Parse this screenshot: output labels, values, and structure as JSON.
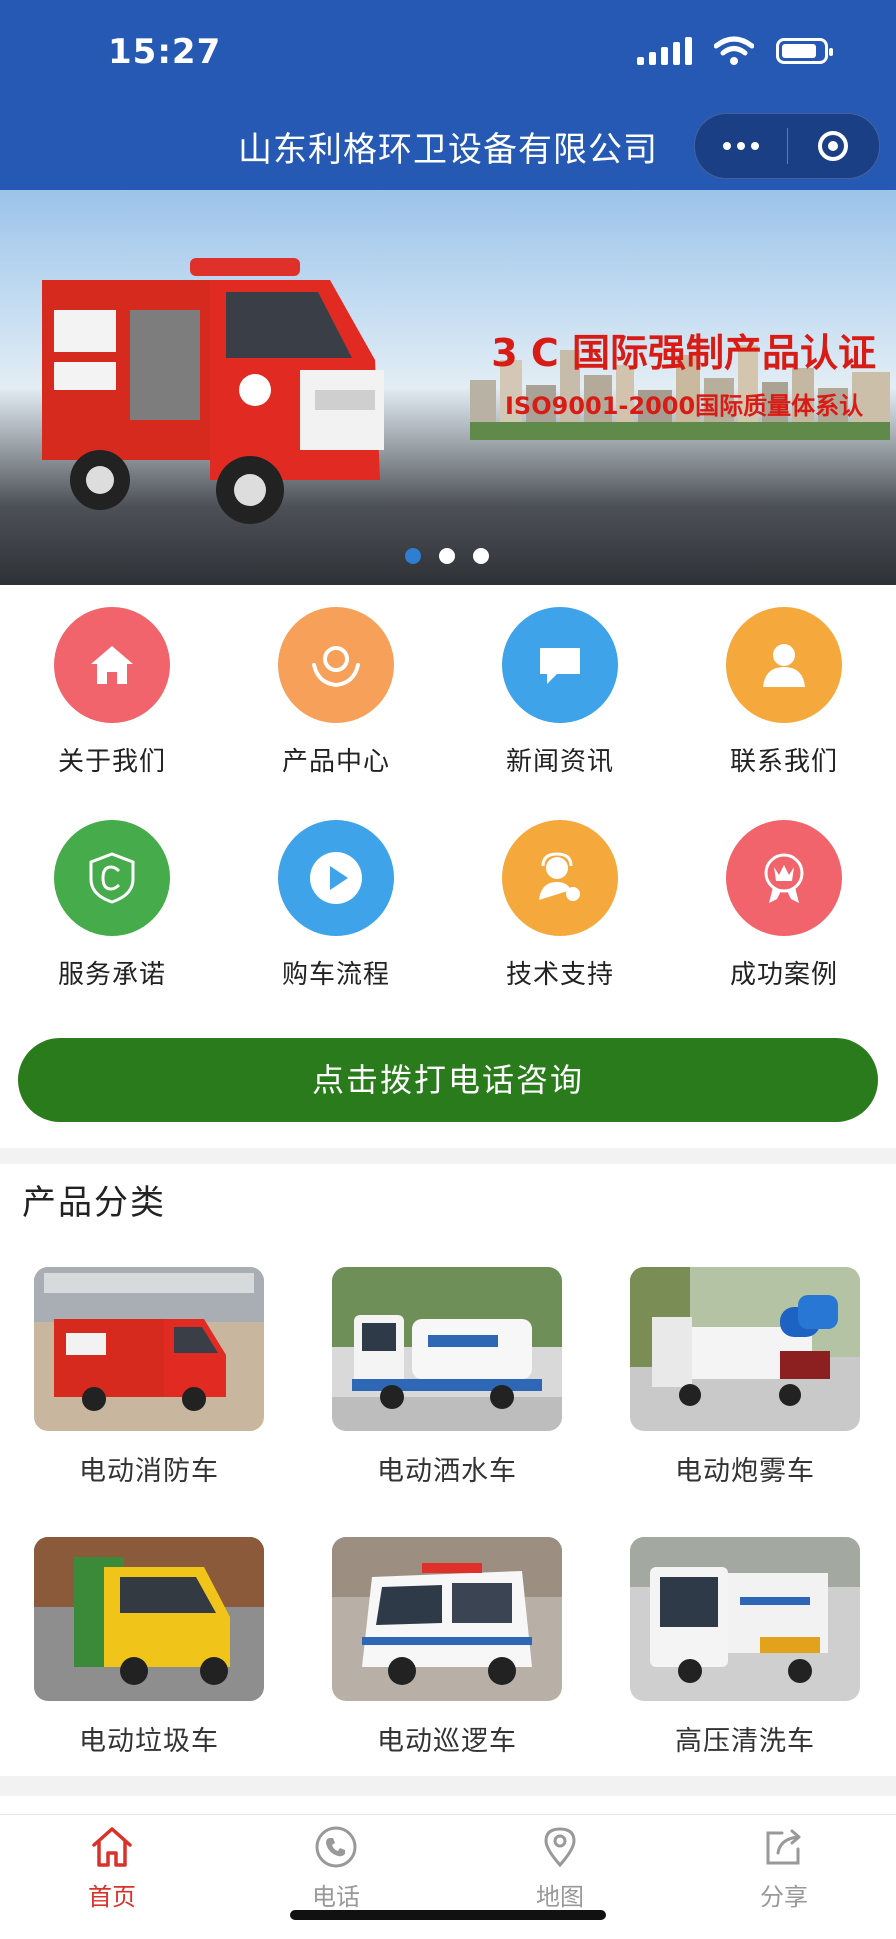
{
  "status_bar": {
    "time": "15:27"
  },
  "nav": {
    "title": "山东利格环卫设备有限公司"
  },
  "banner": {
    "headline": "3 C 国际强制产品认证",
    "subline": "ISO9001-2000国际质量体系认",
    "slide_count": 3,
    "active_slide": 1
  },
  "grid": {
    "items": [
      {
        "label": "关于我们",
        "icon": "home-icon",
        "color": "#f2646c"
      },
      {
        "label": "产品中心",
        "icon": "hands-icon",
        "color": "#f7a05a"
      },
      {
        "label": "新闻资讯",
        "icon": "chat-icon",
        "color": "#3ea3e8"
      },
      {
        "label": "联系我们",
        "icon": "person-icon",
        "color": "#f5a93c"
      },
      {
        "label": "服务承诺",
        "icon": "shield-icon",
        "color": "#46ab4b"
      },
      {
        "label": "购车流程",
        "icon": "play-icon",
        "color": "#3ea3e8"
      },
      {
        "label": "技术支持",
        "icon": "support-icon",
        "color": "#f5a93c"
      },
      {
        "label": "成功案例",
        "icon": "award-icon",
        "color": "#f2646c"
      }
    ]
  },
  "call_button": {
    "label": "点击拨打电话咨询",
    "color": "#2a7b1c"
  },
  "products": {
    "title": "产品分类",
    "items": [
      {
        "label": "电动消防车"
      },
      {
        "label": "电动洒水车"
      },
      {
        "label": "电动炮雾车"
      },
      {
        "label": "电动垃圾车"
      },
      {
        "label": "电动巡逻车"
      },
      {
        "label": "高压清洗车"
      }
    ]
  },
  "tabbar": {
    "items": [
      {
        "label": "首页",
        "icon": "home-icon",
        "active": true
      },
      {
        "label": "电话",
        "icon": "phone-icon",
        "active": false
      },
      {
        "label": "地图",
        "icon": "map-pin-icon",
        "active": false
      },
      {
        "label": "分享",
        "icon": "share-icon",
        "active": false
      }
    ],
    "active_color": "#d9322b",
    "inactive_color": "#999999"
  }
}
